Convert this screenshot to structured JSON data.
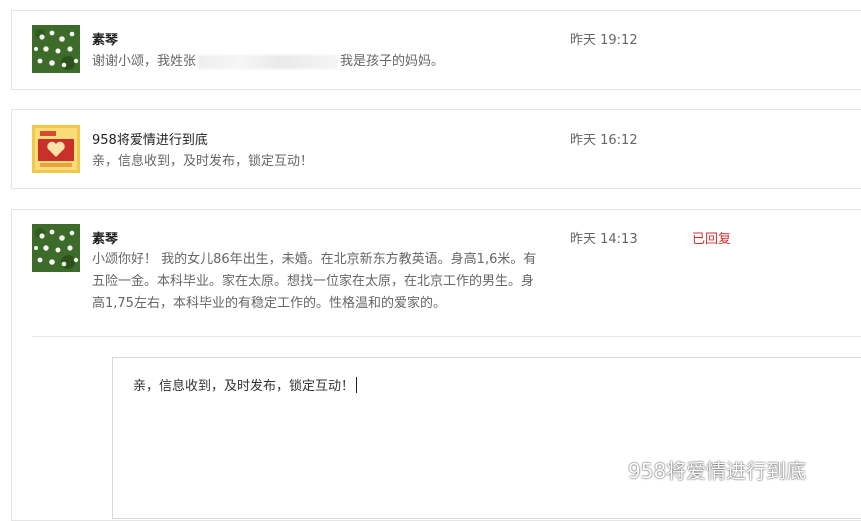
{
  "messages": [
    {
      "name": "素琴",
      "time": "昨天 19:12",
      "text_before": "谢谢小颂，我姓张",
      "text_after": "我是孩子的妈妈。",
      "avatar_icon": "flowers-avatar"
    },
    {
      "name": "958将爱情进行到底",
      "time": "昨天 16:12",
      "text": "亲，信息收到，及时发布，锁定互动！",
      "avatar_icon": "love-logo-avatar"
    },
    {
      "name": "素琴",
      "time": "昨天 14:13",
      "status": "已回复",
      "text_lines": [
        "小颂你好！ 我的女儿86年出生，未婚。在北京新东方教英语。身高1,6米。有",
        "五险一金。本科毕业。家在太原。想找一位家在太原，在北京工作的男生。身",
        "高1,75左右，本科毕业的有稳定工作的。性格温和的爱家的。"
      ],
      "avatar_icon": "flowers-avatar"
    }
  ],
  "reply": {
    "text": "亲，信息收到，及时发布，锁定互动！"
  },
  "watermark": {
    "text": "958将爱情进行到底",
    "icon": "wechat-icon"
  },
  "colors": {
    "status_red": "#d0302f",
    "border": "#e4e4e4",
    "text_gray": "#666666"
  }
}
